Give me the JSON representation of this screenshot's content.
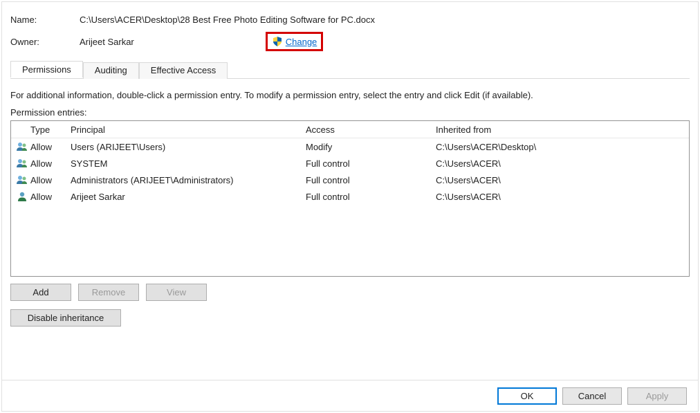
{
  "info": {
    "name_label": "Name:",
    "name_value": "C:\\Users\\ACER\\Desktop\\28 Best Free Photo Editing Software for PC.docx",
    "owner_label": "Owner:",
    "owner_value": "Arijeet Sarkar",
    "change_link": "Change"
  },
  "tabs": {
    "permissions": "Permissions",
    "auditing": "Auditing",
    "effective": "Effective Access"
  },
  "instructions": "For additional information, double-click a permission entry. To modify a permission entry, select the entry and click Edit (if available).",
  "perm_label": "Permission entries:",
  "headers": {
    "type": "Type",
    "principal": "Principal",
    "access": "Access",
    "inherited": "Inherited from"
  },
  "entries": [
    {
      "icon": "group",
      "type": "Allow",
      "principal": "Users (ARIJEET\\Users)",
      "access": "Modify",
      "inherited": "C:\\Users\\ACER\\Desktop\\"
    },
    {
      "icon": "group",
      "type": "Allow",
      "principal": "SYSTEM",
      "access": "Full control",
      "inherited": "C:\\Users\\ACER\\"
    },
    {
      "icon": "group",
      "type": "Allow",
      "principal": "Administrators (ARIJEET\\Administrators)",
      "access": "Full control",
      "inherited": "C:\\Users\\ACER\\"
    },
    {
      "icon": "person",
      "type": "Allow",
      "principal": "Arijeet Sarkar",
      "access": "Full control",
      "inherited": "C:\\Users\\ACER\\"
    }
  ],
  "buttons": {
    "add": "Add",
    "remove": "Remove",
    "view": "View",
    "disable": "Disable inheritance",
    "ok": "OK",
    "cancel": "Cancel",
    "apply": "Apply"
  }
}
